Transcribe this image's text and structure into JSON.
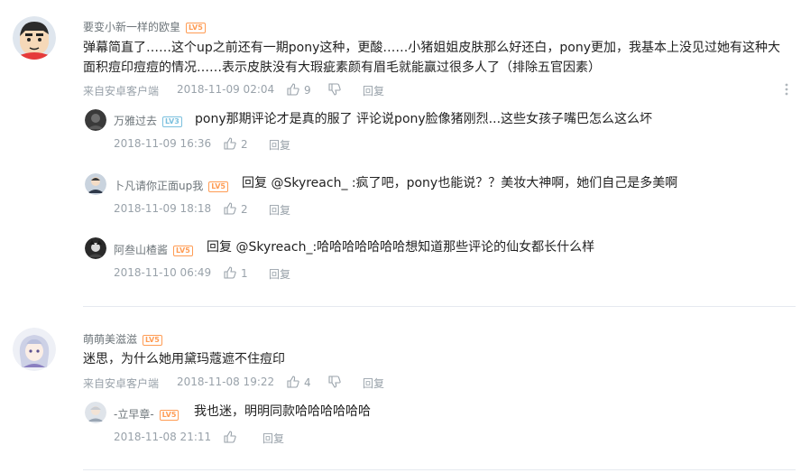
{
  "threads": [
    {
      "user": "要变小新一样的欧皇",
      "level": "LV5",
      "content": "弹幕简直了……这个up之前还有一期pony这种，更酸……小猪姐姐皮肤那么好还白，pony更加，我基本上没见过她有这种大面积痘印痘痘的情况……表示皮肤没有大瑕疵素颜有眉毛就能赢过很多人了（排除五官因素）",
      "source": "来自安卓客户端",
      "time": "2018-11-09 02:04",
      "likes": "9",
      "reply": "回复",
      "avatar": "crayon-shinchan-avatar",
      "replies": [
        {
          "user": "万雅过去",
          "level": "LV3",
          "content": "pony那期评论才是真的服了 评论说pony脸像猪刚烈...这些女孩子嘴巴怎么这么坏",
          "time": "2018-11-09 16:36",
          "likes": "2",
          "reply": "回复"
        },
        {
          "user": "卜凡请你正面up我",
          "level": "LV5",
          "content": "回复 @Skyreach_ :疯了吧，pony也能说？？美妆大神啊，她们自己是多美啊",
          "time": "2018-11-09 18:18",
          "likes": "2",
          "reply": "回复"
        },
        {
          "user": "阿叁山楂酱",
          "level": "LV5",
          "content": "回复 @Skyreach_:哈哈哈哈哈哈哈想知道那些评论的仙女都长什么样",
          "time": "2018-11-10 06:49",
          "likes": "1",
          "reply": "回复"
        }
      ]
    },
    {
      "user": "萌萌美滋滋",
      "level": "LV5",
      "content": "迷思，为什么她用黛玛蔻遮不住痘印",
      "source": "来自安卓客户端",
      "time": "2018-11-08 19:22",
      "likes": "4",
      "reply": "回复",
      "avatar": "anime-girl-avatar",
      "replies": [
        {
          "user": "-立早章-",
          "level": "LV5",
          "content": "我也迷，明明同款哈哈哈哈哈哈",
          "time": "2018-11-08 21:11",
          "likes": "",
          "reply": "回复"
        }
      ]
    }
  ],
  "colors": {
    "username": "#6d757a",
    "meta": "#99a2aa",
    "level5": "#ff9c54",
    "level3": "#7bc0de",
    "divider": "#e5e9ef"
  },
  "icons": {
    "like": "thumbs-up-icon",
    "dislike": "thumbs-down-icon",
    "more": "more-vertical-icon"
  }
}
